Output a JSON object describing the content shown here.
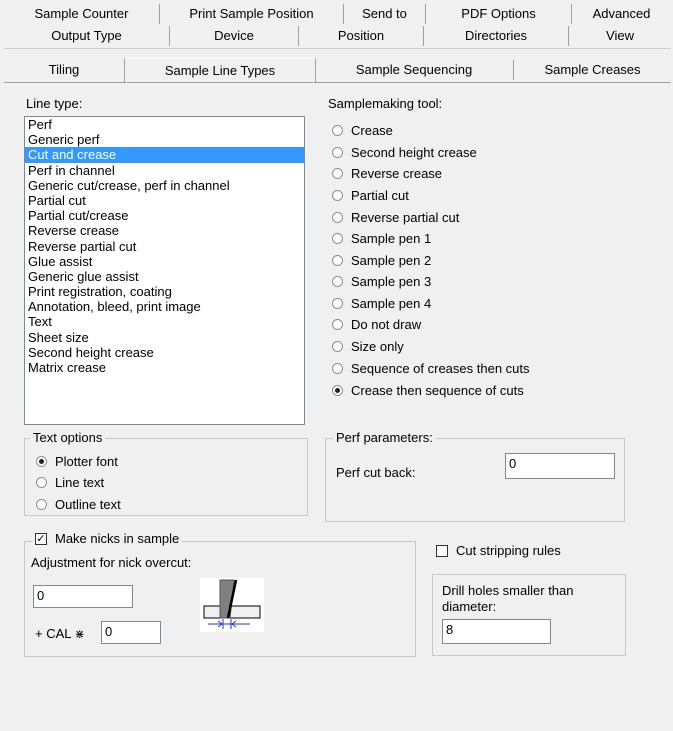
{
  "tabs": {
    "row1": [
      "Sample Counter",
      "Print Sample Position",
      "Send to",
      "PDF Options",
      "Advanced"
    ],
    "row2": [
      "Output Type",
      "Device",
      "Position",
      "Directories",
      "View"
    ],
    "row3": [
      "Tiling",
      "Sample Line Types",
      "Sample Sequencing",
      "Sample Creases"
    ],
    "active": "Sample Line Types"
  },
  "line_type": {
    "label": "Line type:",
    "items": [
      "Perf",
      "Generic perf",
      "Cut and crease",
      "Perf in channel",
      "Generic cut/crease, perf in channel",
      "Partial cut",
      "Partial cut/crease",
      "Reverse crease",
      "Reverse partial cut",
      "Glue assist",
      "Generic glue assist",
      "Print registration, coating",
      "Annotation, bleed, print image",
      "Text",
      "Sheet size",
      "Second height crease",
      "Matrix crease"
    ],
    "selected": "Cut and crease"
  },
  "samplemaking_tool": {
    "label": "Samplemaking tool:",
    "options": [
      "Crease",
      "Second height crease",
      "Reverse crease",
      "Partial cut",
      "Reverse partial cut",
      "Sample pen 1",
      "Sample pen 2",
      "Sample pen 3",
      "Sample pen 4",
      "Do not draw",
      "Size only",
      "Sequence of creases then cuts",
      "Crease then sequence of cuts"
    ],
    "selected": "Crease then sequence of cuts"
  },
  "text_options": {
    "title": "Text options",
    "options": [
      "Plotter font",
      "Line text",
      "Outline text"
    ],
    "selected": "Plotter font"
  },
  "perf_parameters": {
    "title": "Perf parameters:",
    "cut_back_label": "Perf cut back:",
    "cut_back_value": "0"
  },
  "nicks": {
    "make_nicks_label": "Make nicks in sample",
    "make_nicks_checked": true,
    "adjustment_label": "Adjustment for nick overcut:",
    "adjustment_value": "0",
    "cal_label": "+ CAL",
    "cal_icon": "cal-symbol-icon",
    "cal_value": "0"
  },
  "cut_stripping": {
    "label": "Cut stripping rules",
    "checked": false
  },
  "drill_holes": {
    "label_line1": "Drill holes smaller than",
    "label_line2": "diameter:",
    "value": "8"
  }
}
